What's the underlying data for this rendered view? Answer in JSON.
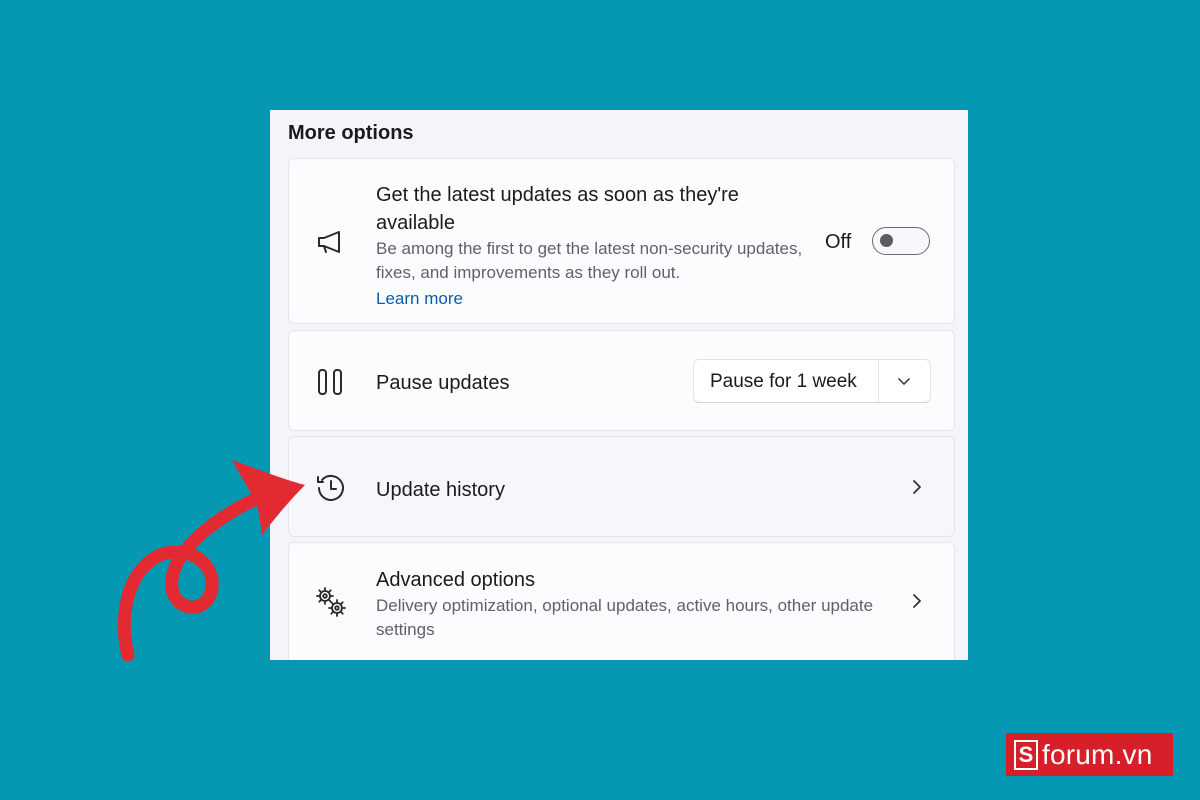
{
  "panel": {
    "section_title": "More options"
  },
  "cards": {
    "latest": {
      "title": "Get the latest updates as soon as they're available",
      "description": "Be among the first to get the latest non-security updates, fixes, and improvements as they roll out.",
      "link": "Learn more",
      "toggle_state_label": "Off",
      "toggle_on": false,
      "icon": "megaphone-icon"
    },
    "pause": {
      "title": "Pause updates",
      "dropdown_value": "Pause for 1 week",
      "icon": "pause-icon"
    },
    "history": {
      "title": "Update history",
      "icon": "history-icon"
    },
    "advanced": {
      "title": "Advanced options",
      "description": "Delivery optimization, optional updates, active hours, other update settings",
      "icon": "gears-icon"
    }
  },
  "annotation": {
    "arrow_color": "#e32a33"
  },
  "brand": {
    "mark": "S",
    "text": "forum.vn",
    "color": "#d71f29"
  },
  "colors": {
    "background": "#0498b3",
    "link": "#0b5cab"
  }
}
